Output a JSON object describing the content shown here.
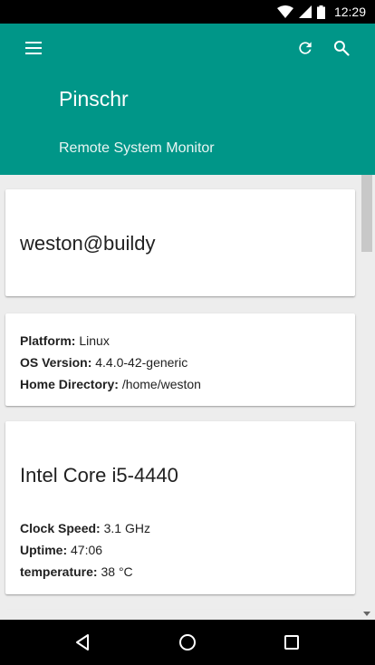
{
  "status_bar": {
    "time": "12:29",
    "icons": [
      "wifi-icon",
      "signal-icon",
      "battery-icon"
    ]
  },
  "app_bar": {
    "title": "Pinschr",
    "subtitle": "Remote System Monitor",
    "background_color": "#009688",
    "actions": [
      "menu-icon",
      "refresh-icon",
      "search-icon"
    ]
  },
  "cards": {
    "user": {
      "host": "weston@buildy"
    },
    "platform": {
      "items": [
        {
          "label": "Platform:",
          "value": "Linux"
        },
        {
          "label": "OS Version:",
          "value": "4.4.0-42-generic"
        },
        {
          "label": "Home Directory:",
          "value": "/home/weston"
        }
      ]
    },
    "cpu": {
      "name": "Intel Core i5-4440",
      "items": [
        {
          "label": "Clock Speed:",
          "value": "3.1 GHz"
        },
        {
          "label": "Uptime:",
          "value": "47:06"
        },
        {
          "label": "temperature:",
          "value": "38 °C"
        }
      ]
    }
  },
  "nav_bar": {
    "buttons": [
      "back-icon",
      "home-icon",
      "recent-apps-icon"
    ]
  }
}
